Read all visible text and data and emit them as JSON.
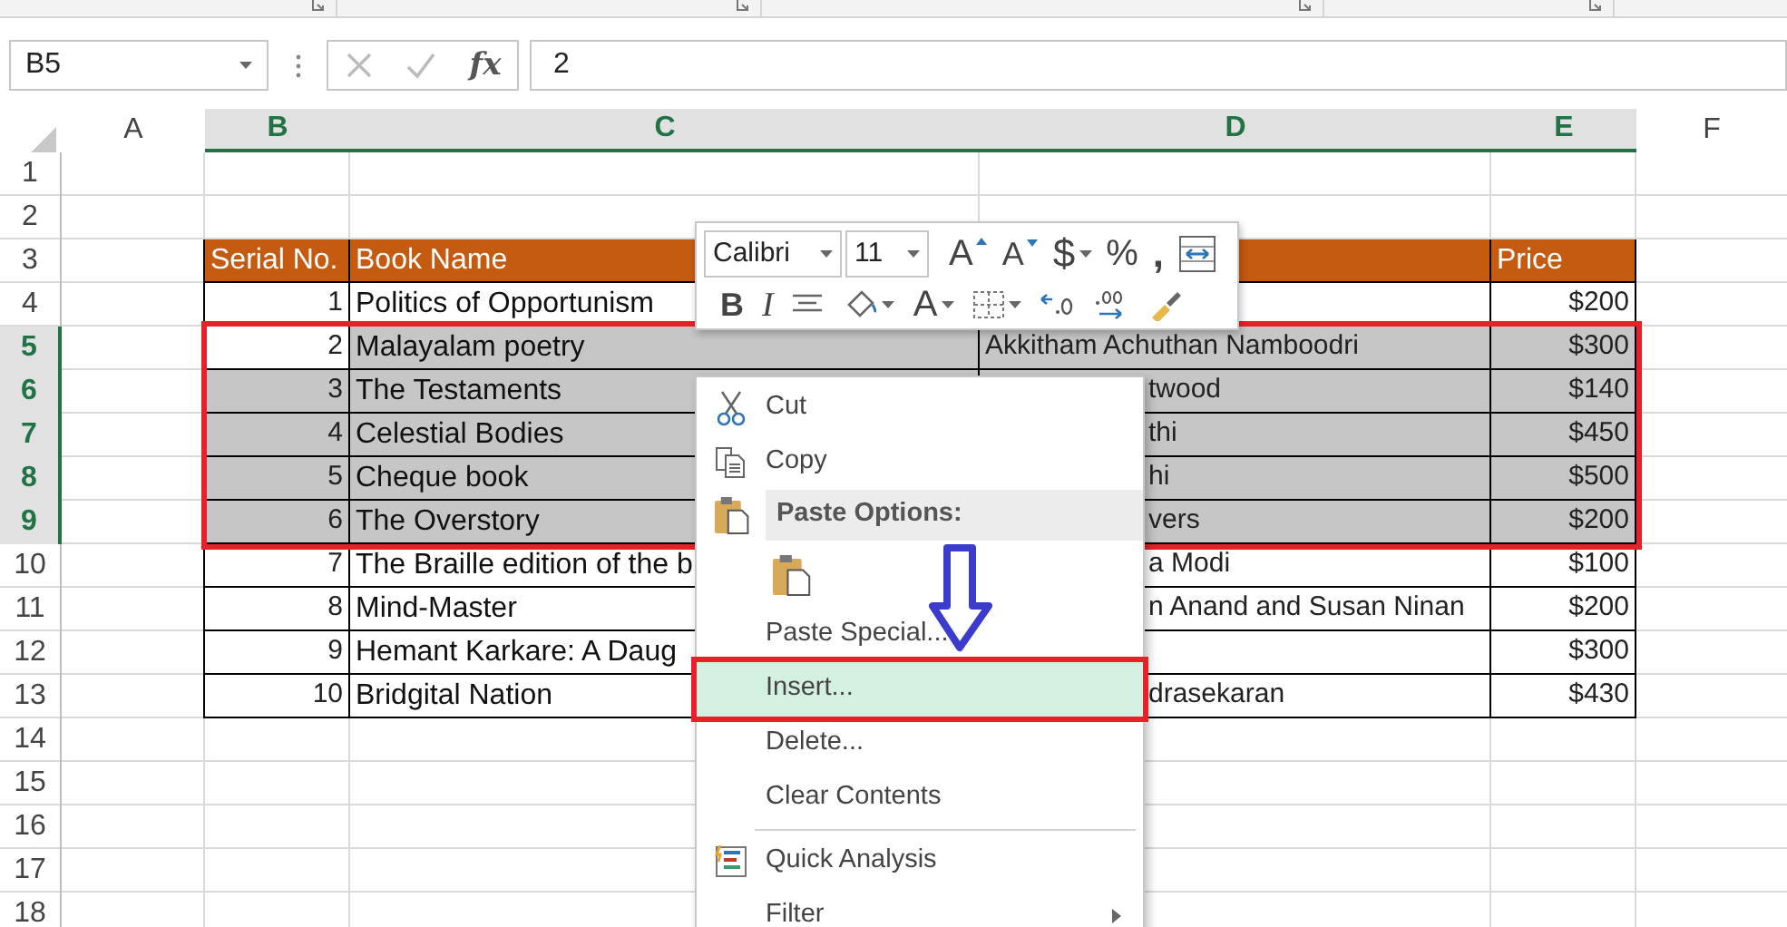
{
  "name_box": {
    "value": "B5"
  },
  "formula_bar": {
    "function_button": "fx",
    "value": "2"
  },
  "columns": [
    {
      "label": "A",
      "selected": false
    },
    {
      "label": "B",
      "selected": true
    },
    {
      "label": "C",
      "selected": true
    },
    {
      "label": "D",
      "selected": true
    },
    {
      "label": "E",
      "selected": true
    },
    {
      "label": "F",
      "selected": false
    }
  ],
  "selection_frame": true,
  "rows": [
    {
      "label": "1",
      "kind": "blank",
      "selected": false
    },
    {
      "label": "2",
      "kind": "blank",
      "selected": false
    },
    {
      "label": "3",
      "kind": "header",
      "selected": false,
      "cells": {
        "B": "Serial No.",
        "C": "Book Name",
        "E": "Price"
      }
    },
    {
      "label": "4",
      "kind": "data",
      "selected": false,
      "cells": {
        "B": "1",
        "C": "Politics of Opportunism",
        "E": "$200"
      }
    },
    {
      "label": "5",
      "kind": "data",
      "selected": true,
      "cells": {
        "B": {
          "text": "2",
          "active": true
        },
        "C": {
          "text": "Malayalam poetry",
          "active": false
        },
        "D": {
          "text": "Akkitham Achuthan Namboodri",
          "active": false
        },
        "E": {
          "text": "$300",
          "active": false
        }
      }
    },
    {
      "label": "6",
      "kind": "data",
      "selected": true,
      "cells": {
        "B": {
          "text": "3",
          "active": false
        },
        "C": {
          "text": "The Testaments",
          "active": false
        },
        "D": {
          "text": "twood",
          "active": false
        },
        "E": {
          "text": "$140",
          "active": false
        }
      }
    },
    {
      "label": "7",
      "kind": "data",
      "selected": true,
      "cells": {
        "B": {
          "text": "4",
          "active": false
        },
        "C": {
          "text": "Celestial Bodies",
          "active": false
        },
        "D": {
          "text": "thi",
          "active": false
        },
        "E": {
          "text": "$450",
          "active": false
        }
      }
    },
    {
      "label": "8",
      "kind": "data",
      "selected": true,
      "cells": {
        "B": {
          "text": "5",
          "active": false
        },
        "C": {
          "text": "Cheque book",
          "active": false
        },
        "D": {
          "text": "hi",
          "active": false
        },
        "E": {
          "text": "$500",
          "active": false
        }
      }
    },
    {
      "label": "9",
      "kind": "data",
      "selected": true,
      "cells": {
        "B": {
          "text": "6",
          "active": false
        },
        "C": {
          "text": "The Overstory",
          "active": false
        },
        "D": {
          "text": "vers",
          "active": false
        },
        "E": {
          "text": "$200",
          "active": false
        }
      }
    },
    {
      "label": "10",
      "kind": "data",
      "selected": false,
      "cells": {
        "B": "7",
        "C": "The Braille edition of the b",
        "D": "a Modi",
        "E": "$100"
      }
    },
    {
      "label": "11",
      "kind": "data",
      "selected": false,
      "cells": {
        "B": "8",
        "C": "Mind-Master",
        "D": "n Anand and Susan Ninan",
        "E": "$200"
      }
    },
    {
      "label": "12",
      "kind": "data",
      "selected": false,
      "cells": {
        "B": "9",
        "C": "Hemant Karkare: A Daug",
        "E": "$300"
      }
    },
    {
      "label": "13",
      "kind": "data",
      "selected": false,
      "cells": {
        "B": "10",
        "C": "Bridgital Nation",
        "D": "drasekaran",
        "E": "$430"
      }
    },
    {
      "label": "14",
      "kind": "blank",
      "selected": false
    },
    {
      "label": "15",
      "kind": "blank",
      "selected": false
    },
    {
      "label": "16",
      "kind": "blank",
      "selected": false
    },
    {
      "label": "17",
      "kind": "blank",
      "selected": false
    },
    {
      "label": "18",
      "kind": "blank",
      "selected": false
    }
  ],
  "mini_toolbar": {
    "font": "Calibri",
    "size": "11",
    "tools": [
      [
        {
          "kind": "grow",
          "label": "A"
        },
        {
          "kind": "shrink",
          "label": "A"
        },
        {
          "kind": "currency",
          "label": "$"
        },
        {
          "kind": "percent",
          "label": "%"
        },
        {
          "kind": "comma",
          "label": ","
        },
        {
          "kind": "wrap"
        }
      ],
      [
        {
          "kind": "bold",
          "label": "B"
        },
        {
          "kind": "italic",
          "label": "I"
        },
        {
          "kind": "align"
        },
        {
          "kind": "fill"
        },
        {
          "kind": "fontcolor",
          "label": "A"
        },
        {
          "kind": "borders"
        },
        {
          "kind": "decrease"
        },
        {
          "kind": "increase"
        },
        {
          "kind": "painter"
        }
      ]
    ]
  },
  "context_menu": [
    {
      "kind": "cut",
      "label": "Cut",
      "highlighted": false
    },
    {
      "kind": "copy",
      "label": "Copy",
      "highlighted": false
    },
    {
      "kind": "heading",
      "label": "Paste Options:"
    },
    {
      "kind": "paste"
    },
    {
      "kind": "item",
      "label": "Paste Special...",
      "highlighted": false
    },
    {
      "kind": "item",
      "label": "Insert...",
      "highlighted": true
    },
    {
      "kind": "item",
      "label": "Delete...",
      "highlighted": false
    },
    {
      "kind": "item",
      "label": "Clear Contents",
      "highlighted": false
    },
    {
      "kind": "separator"
    },
    {
      "kind": "analysis",
      "label": "Quick Analysis",
      "highlighted": false
    },
    {
      "kind": "submenu",
      "label": "Filter",
      "highlighted": false
    }
  ]
}
